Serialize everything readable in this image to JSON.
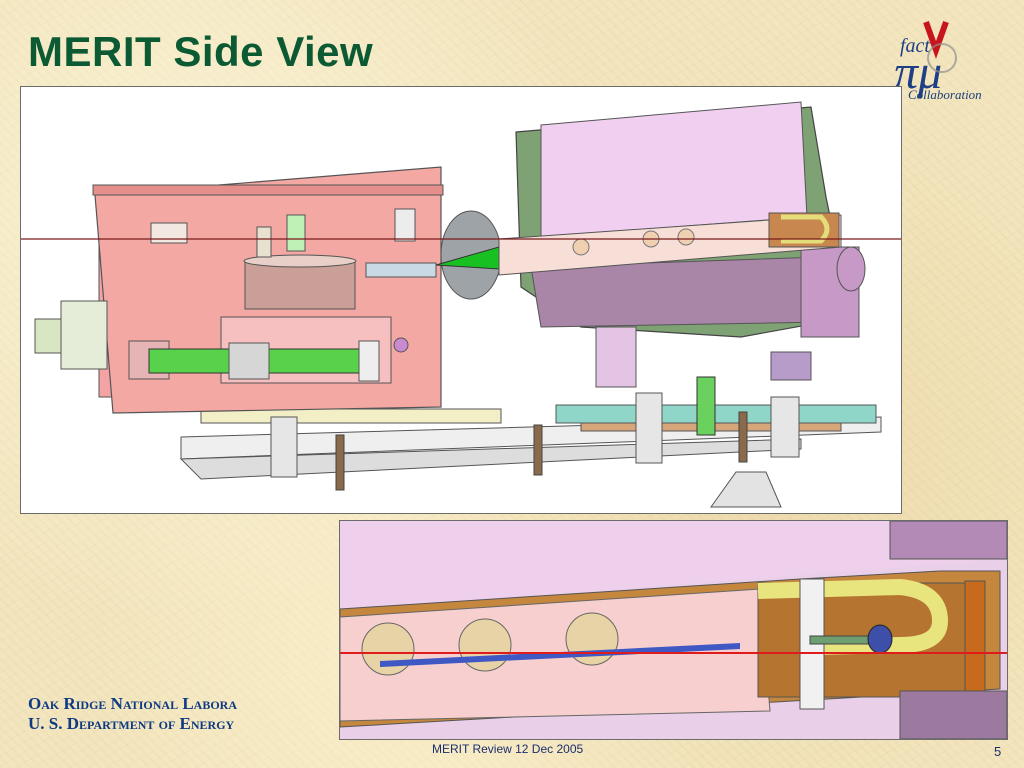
{
  "slide": {
    "title": "MERIT Side View",
    "page_number": "5",
    "footer_center": "MERIT Review 12 Dec 2005"
  },
  "logo": {
    "word": "fact",
    "symbols": "πμ",
    "label": "Collaboration"
  },
  "organization": {
    "line1": "Oak Ridge National Labora",
    "line2": "U. S. Department of Energy"
  },
  "figures": {
    "main": "cad-side-view",
    "detail": "cad-target-detail"
  },
  "colors": {
    "title": "#0c5a33",
    "org_text": "#0d3a82",
    "footer_text": "#1a2e6e"
  }
}
